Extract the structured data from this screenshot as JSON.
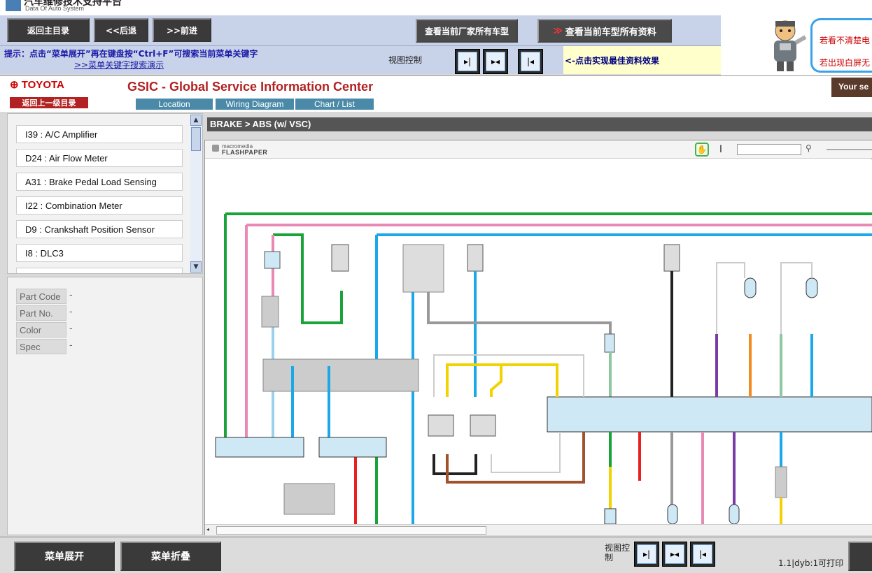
{
  "app": {
    "title_cn": "汽车维修技术支持平台",
    "title_en": "Data Of Auto System"
  },
  "topbar": {
    "home": "返回主目录",
    "back": "<<后退",
    "forward": ">>前进",
    "all_models": "查看当前厂家所有车型",
    "all_docs": "查看当前车型所有资料"
  },
  "hint": {
    "line1": "提示：点击“菜单展开”再在键盘按“Ctrl+F”可搜索当前菜单关键字",
    "demo_link": ">>菜单关键字搜索演示",
    "view_label": "视图控制",
    "best_effect": "<-点击实现最佳资料效果"
  },
  "notice": {
    "line1": "若看不清楚电",
    "line2": "若出现白屏无"
  },
  "header": {
    "brand": "TOYOTA",
    "title": "GSIC - Global Service Information Center",
    "back_level": "返回上一级目录",
    "tabs": [
      "Location",
      "Wiring Diagram",
      "Chart / List"
    ],
    "your_service": "Your se"
  },
  "components": [
    "I39 : A/C Amplifier",
    "D24 : Air Flow Meter",
    "A31 : Brake Pedal Load Sensing",
    "I22 : Combination Meter",
    "D9 : Crankshaft Position Sensor",
    "I8 : DLC3"
  ],
  "part_info": {
    "labels": [
      "Part Code",
      "Part No.",
      "Color",
      "Spec"
    ],
    "values": [
      "-",
      "-",
      "-",
      "-"
    ]
  },
  "content": {
    "breadcrumb": "BRAKE > ABS (w/ VSC)",
    "viewer_brand_top": "macromedia",
    "viewer_brand": "FLASHPAPER"
  },
  "bottom": {
    "expand": "菜单展开",
    "collapse": "菜单折叠",
    "view_label": "视图控制",
    "page_info": "1.1|dyb:1可打印"
  },
  "colors": {
    "wire_green": "#1aa33a",
    "wire_pink": "#e889b6",
    "wire_blue": "#1aa8e8",
    "wire_gray": "#999999",
    "wire_yellow": "#f2d200",
    "wire_black": "#222222",
    "wire_brown": "#a0522d",
    "wire_red": "#e82020",
    "wire_purple": "#7a3aa8",
    "wire_orange": "#f28a20",
    "ecu_fill": "#cfe8f6"
  }
}
